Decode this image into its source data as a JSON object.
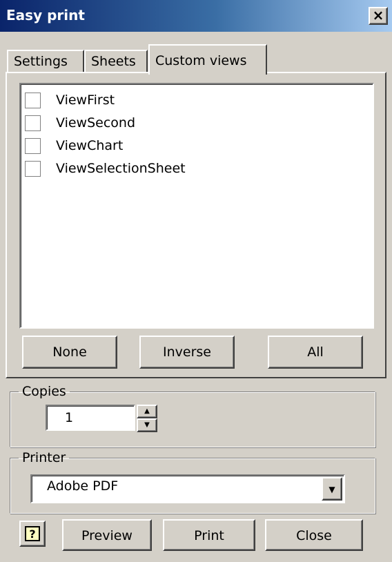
{
  "window": {
    "title": "Easy print",
    "close_glyph": "×"
  },
  "tabs": [
    {
      "label": "Settings",
      "active": false
    },
    {
      "label": "Sheets",
      "active": false
    },
    {
      "label": "Custom views",
      "active": true
    }
  ],
  "views": [
    {
      "label": "ViewFirst",
      "checked": false
    },
    {
      "label": "ViewSecond",
      "checked": false
    },
    {
      "label": "ViewChart",
      "checked": false
    },
    {
      "label": "ViewSelectionSheet",
      "checked": false
    }
  ],
  "selection_buttons": {
    "none": "None",
    "inverse": "Inverse",
    "all": "All"
  },
  "copies": {
    "legend": "Copies",
    "value": "1"
  },
  "printer": {
    "legend": "Printer",
    "value": "Adobe PDF"
  },
  "footer": {
    "help_glyph": "?",
    "preview": "Preview",
    "print": "Print",
    "close": "Close"
  },
  "icons": {
    "close": "close-icon",
    "help": "help-icon",
    "spin_up": "arrow-up-icon",
    "spin_down": "arrow-down-icon",
    "dropdown": "chevron-down-icon"
  },
  "colors": {
    "face": "#d4d0c8",
    "title_start": "#0a246a",
    "title_end": "#a6caf0"
  }
}
